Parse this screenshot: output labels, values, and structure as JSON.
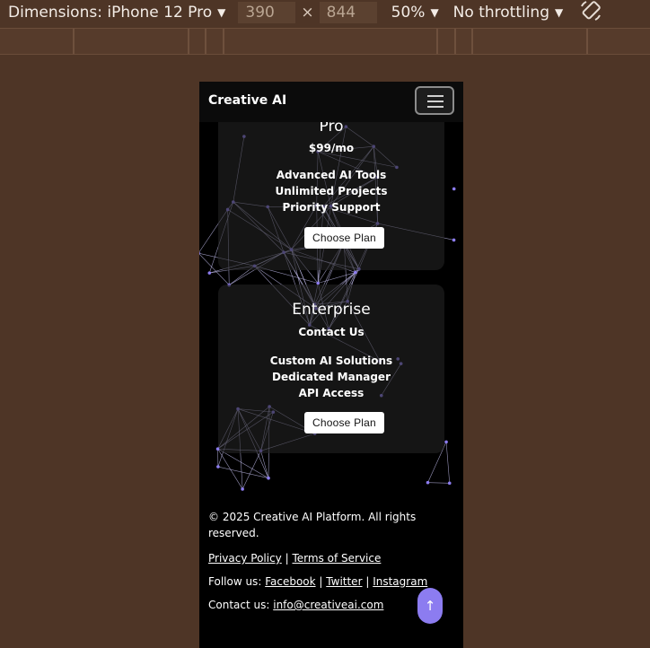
{
  "devtools": {
    "dimensions_label": "Dimensions: iPhone 12 Pro",
    "width": "390",
    "times": "×",
    "height": "844",
    "zoom": "50%",
    "throttling": "No throttling",
    "rotate_icon": "rotate-icon"
  },
  "site": {
    "brand": "Creative AI",
    "menu_icon": "hamburger-menu-icon"
  },
  "plans": [
    {
      "name": "Pro",
      "price": "$99/mo",
      "features": [
        "Advanced AI Tools",
        "Unlimited Projects",
        "Priority Support"
      ],
      "button": "Choose Plan"
    },
    {
      "name": "Enterprise",
      "price": "Contact Us",
      "features": [
        "Custom AI Solutions",
        "Dedicated Manager",
        "API Access"
      ],
      "button": "Choose Plan"
    }
  ],
  "footer": {
    "copyright": "© 2025 Creative AI Platform. All rights reserved.",
    "privacy": "Privacy Policy",
    "sep": "|",
    "terms": "Terms of Service",
    "follow_label": "Follow us:",
    "facebook": "Facebook",
    "twitter": "Twitter",
    "instagram": "Instagram",
    "contact_label": "Contact us:",
    "email": "info@creativeai.com"
  },
  "scroll_top": "↑",
  "colors": {
    "page_bg": "#000000",
    "devtools_bg": "#4e3526",
    "accent": "#8c7cf0",
    "network_line": "#c9c4f5"
  }
}
